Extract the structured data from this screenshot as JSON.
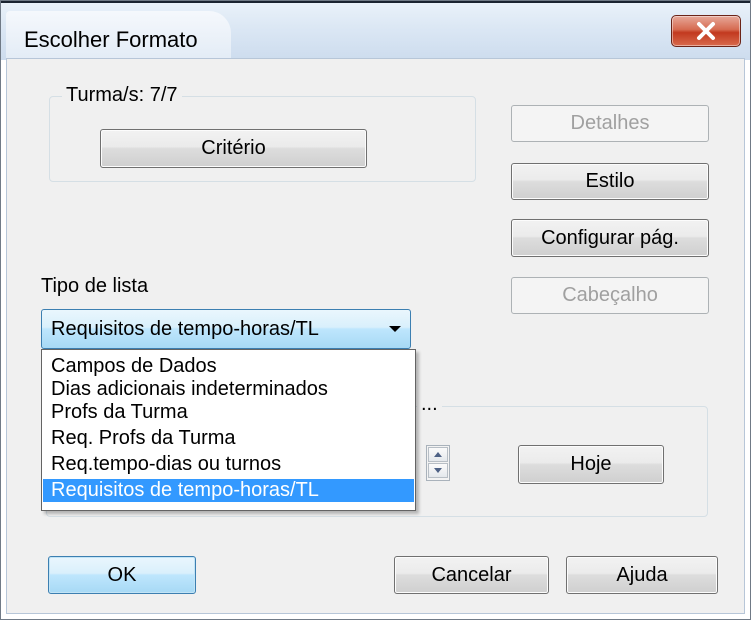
{
  "window": {
    "title": "Escolher Formato"
  },
  "group": {
    "legend": "Turma/s: 7/7",
    "criteria_button": "Critério"
  },
  "buttons": {
    "details": "Detalhes",
    "style": "Estilo",
    "page_setup": "Configurar pág.",
    "header": "Cabeçalho",
    "today": "Hoje",
    "ok": "OK",
    "cancel": "Cancelar",
    "help": "Ajuda"
  },
  "list_type": {
    "label": "Tipo de lista",
    "selected": "Requisitos de tempo-horas/TL",
    "options": [
      "Campos de Dados",
      "Dias adicionais indeterminados",
      "Profs da Turma",
      "Req. Profs da Turma",
      "Req.tempo-dias ou turnos",
      "Requisitos de tempo-horas/TL"
    ],
    "highlighted_index": 5
  },
  "colors": {
    "selection": "#3399ff",
    "default_button": "#bee6fd",
    "close_button": "#c2391f"
  },
  "icons": {
    "close": "close-icon",
    "dropdown": "chevron-down-icon",
    "spin_up": "spin-up-icon",
    "spin_down": "spin-down-icon"
  }
}
